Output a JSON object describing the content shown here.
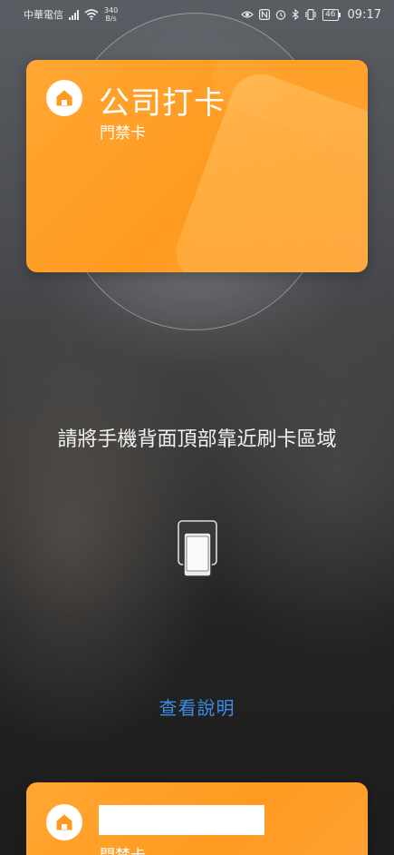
{
  "status_bar": {
    "carrier": "中華電信",
    "net_speed_value": "340",
    "net_speed_unit": "B/s",
    "battery": "46",
    "time": "09:17"
  },
  "cards": {
    "main": {
      "title": "公司打卡",
      "subtitle": "門禁卡"
    },
    "secondary": {
      "subtitle": "門禁卡"
    }
  },
  "instruction": "請將手機背面頂部靠近刷卡區域",
  "help_link": "查看說明",
  "colors": {
    "card_orange": "#ff9a1f",
    "link_blue": "#3c8ce8"
  }
}
